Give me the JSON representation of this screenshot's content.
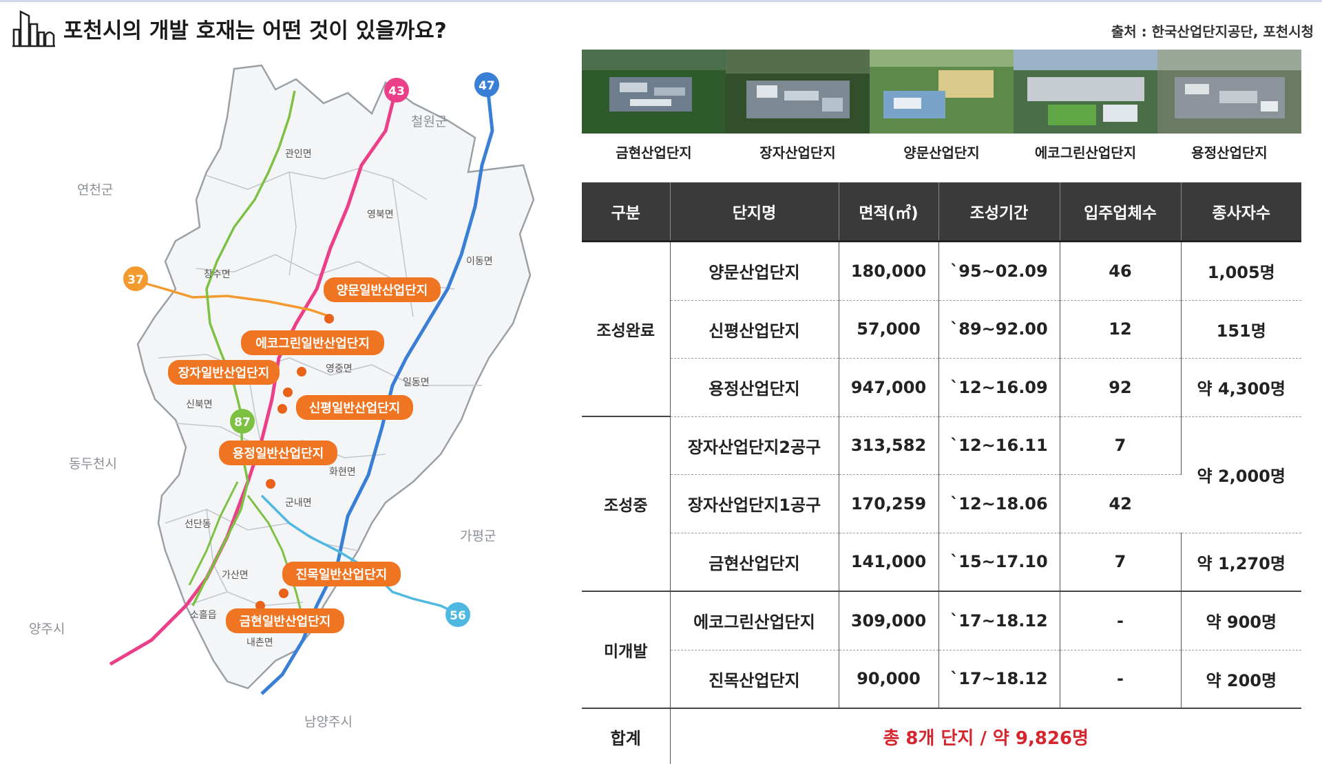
{
  "header": {
    "title": "포천시의 개발 호재는 어떤 것이 있을까요?",
    "source": "출처 : 한국산업단지공단, 포천시청",
    "icon": "city-buildings-icon"
  },
  "map": {
    "neighbors": [
      "연천군",
      "철원군",
      "동두천시",
      "가평군",
      "양주시",
      "남양주시"
    ],
    "towns": [
      "관인면",
      "영북면",
      "이동면",
      "창수면",
      "영중면",
      "일동면",
      "신북면",
      "화현면",
      "군내면",
      "선단동",
      "가산면",
      "소흘읍",
      "내촌면"
    ],
    "routes": [
      {
        "number": "43",
        "color": "#ec3f8a"
      },
      {
        "number": "47",
        "color": "#3a7fd6"
      },
      {
        "number": "37",
        "color": "#f29a2e"
      },
      {
        "number": "87",
        "color": "#7cc142"
      },
      {
        "number": "56",
        "color": "#4fb8e0"
      }
    ],
    "complexes": [
      "양문일반산업단지",
      "에코그린일반산업단지",
      "장자일반산업단지",
      "신평일반산업단지",
      "용정일반산업단지",
      "진목일반산업단지",
      "금현일반산업단지"
    ],
    "colors": {
      "label": "#f07522",
      "marker": "#e8621a",
      "border": "#9aa0a6",
      "fill": "#f4f5f6"
    }
  },
  "photos": [
    {
      "caption": "금현산업단지"
    },
    {
      "caption": "장자산업단지"
    },
    {
      "caption": "양문산업단지"
    },
    {
      "caption": "에코그린산업단지"
    },
    {
      "caption": "용정산업단지"
    }
  ],
  "table": {
    "headers": [
      "구분",
      "단지명",
      "면적(㎡)",
      "조성기간",
      "입주업체수",
      "종사자수"
    ],
    "groups": [
      "조성완료",
      "조성중",
      "미개발"
    ],
    "rows": [
      {
        "name": "양문산업단지",
        "area": "180,000",
        "period": "`95~02.09",
        "companies": "46",
        "workers": "1,005명"
      },
      {
        "name": "신평산업단지",
        "area": "57,000",
        "period": "`89~92.00",
        "companies": "12",
        "workers": "151명"
      },
      {
        "name": "용정산업단지",
        "area": "947,000",
        "period": "`12~16.09",
        "companies": "92",
        "workers": "약 4,300명"
      },
      {
        "name": "장자산업단지2공구",
        "area": "313,582",
        "period": "`12~16.11",
        "companies": "7",
        "workers": "약 2,000명"
      },
      {
        "name": "장자산업단지1공구",
        "area": "170,259",
        "period": "`12~18.06",
        "companies": "42",
        "workers": ""
      },
      {
        "name": "금현산업단지",
        "area": "141,000",
        "period": "`15~17.10",
        "companies": "7",
        "workers": "약 1,270명"
      },
      {
        "name": "에코그린산업단지",
        "area": "309,000",
        "period": "`17~18.12",
        "companies": "-",
        "workers": "약 900명"
      },
      {
        "name": "진목산업단지",
        "area": "90,000",
        "period": "`17~18.12",
        "companies": "-",
        "workers": "약 200명"
      }
    ],
    "total_label": "합계",
    "total_value": "총 8개 단지 / 약 9,826명",
    "total_color": "#d7252e"
  }
}
